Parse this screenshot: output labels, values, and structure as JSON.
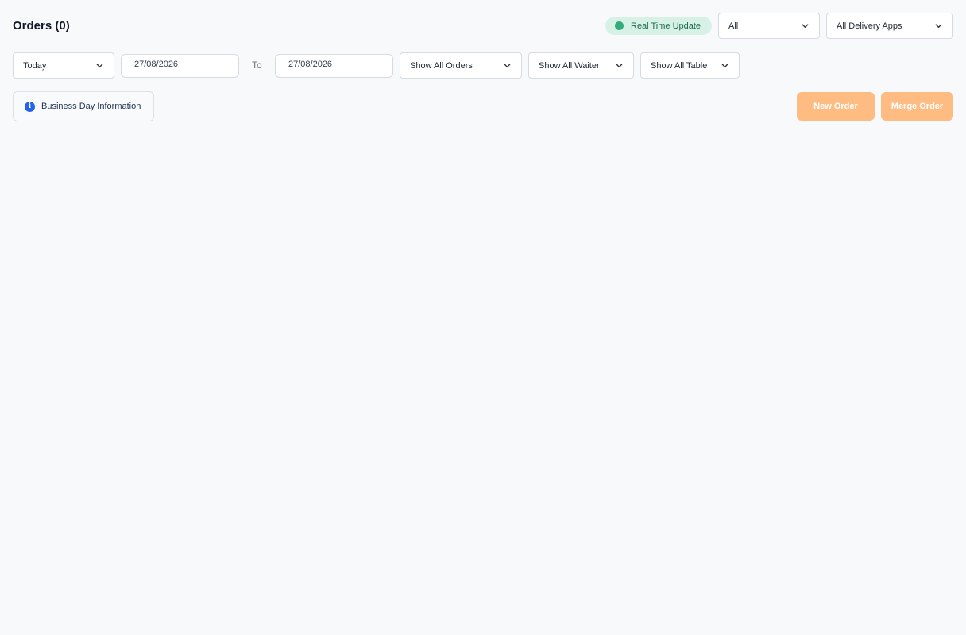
{
  "header": {
    "title": "Orders (0)",
    "realtime_label": "Real Time Update",
    "status_filter": "All",
    "delivery_filter": "All Delivery Apps"
  },
  "filters": {
    "period": "Today",
    "date_from": "27/08/2026",
    "to_label": "To",
    "date_to": "27/08/2026",
    "orders": "Show All Orders",
    "waiter": "Show All Waiter",
    "table": "Show All Table"
  },
  "actions": {
    "business_day_label": "Business Day Information",
    "new_order_label": "New Order",
    "merge_order_label": "Merge Order"
  },
  "colors": {
    "accent": "#ffbc82",
    "realtime_bg": "#d8f1e6",
    "realtime_dot": "#31ad7c",
    "info_icon": "#2563eb",
    "background": "#f7f9fb"
  },
  "icons": {
    "dropdown": "chevron-down-icon",
    "info": "info-icon",
    "status": "dot-icon"
  }
}
